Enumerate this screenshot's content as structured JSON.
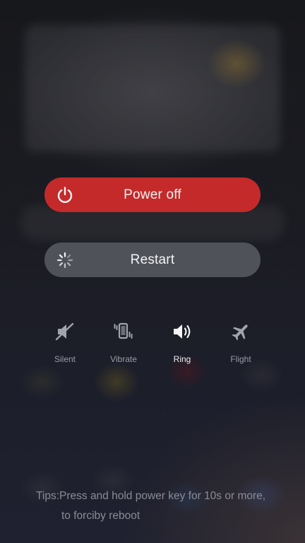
{
  "power_menu": {
    "power_off": {
      "label": "Power off",
      "icon": "power-icon",
      "color": "#c42a2a"
    },
    "restart": {
      "label": "Restart",
      "icon": "spinner-icon",
      "color": "#50525a"
    }
  },
  "sound_modes": {
    "selected": "Ring",
    "items": [
      {
        "label": "Silent",
        "icon": "silent-icon"
      },
      {
        "label": "Vibrate",
        "icon": "vibrate-icon"
      },
      {
        "label": "Ring",
        "icon": "speaker-icon"
      },
      {
        "label": "Flight",
        "icon": "airplane-icon"
      }
    ]
  },
  "tips": {
    "line1": "Tips:Press and hold power key for 10s or more,",
    "line2": "to forciby reboot"
  }
}
